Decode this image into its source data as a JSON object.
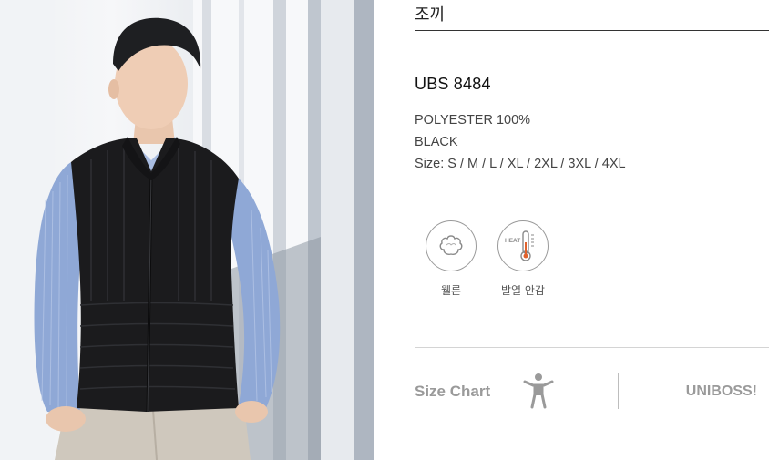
{
  "product_photo": {
    "alt": "model wearing black quilted vest over striped shirt"
  },
  "product": {
    "category": "조끼",
    "model_code": "UBS 8484",
    "material": "POLYESTER 100%",
    "color": "BLACK",
    "sizes": "Size: S / M / L / XL / 2XL / 3XL / 4XL"
  },
  "features": [
    {
      "label": "웰론",
      "icon": "cotton-icon"
    },
    {
      "label": "발열 안감",
      "icon": "heat-thermometer-icon",
      "icon_text": "HEAT"
    }
  ],
  "footer": {
    "size_chart_label": "Size Chart",
    "size_chart_icon": "person-icon",
    "brand": "UNIBOSS!"
  },
  "colors": {
    "muted_text": "#9a9a9a",
    "vest": "#1b1b1d",
    "shirt": "#8fa8d6"
  }
}
